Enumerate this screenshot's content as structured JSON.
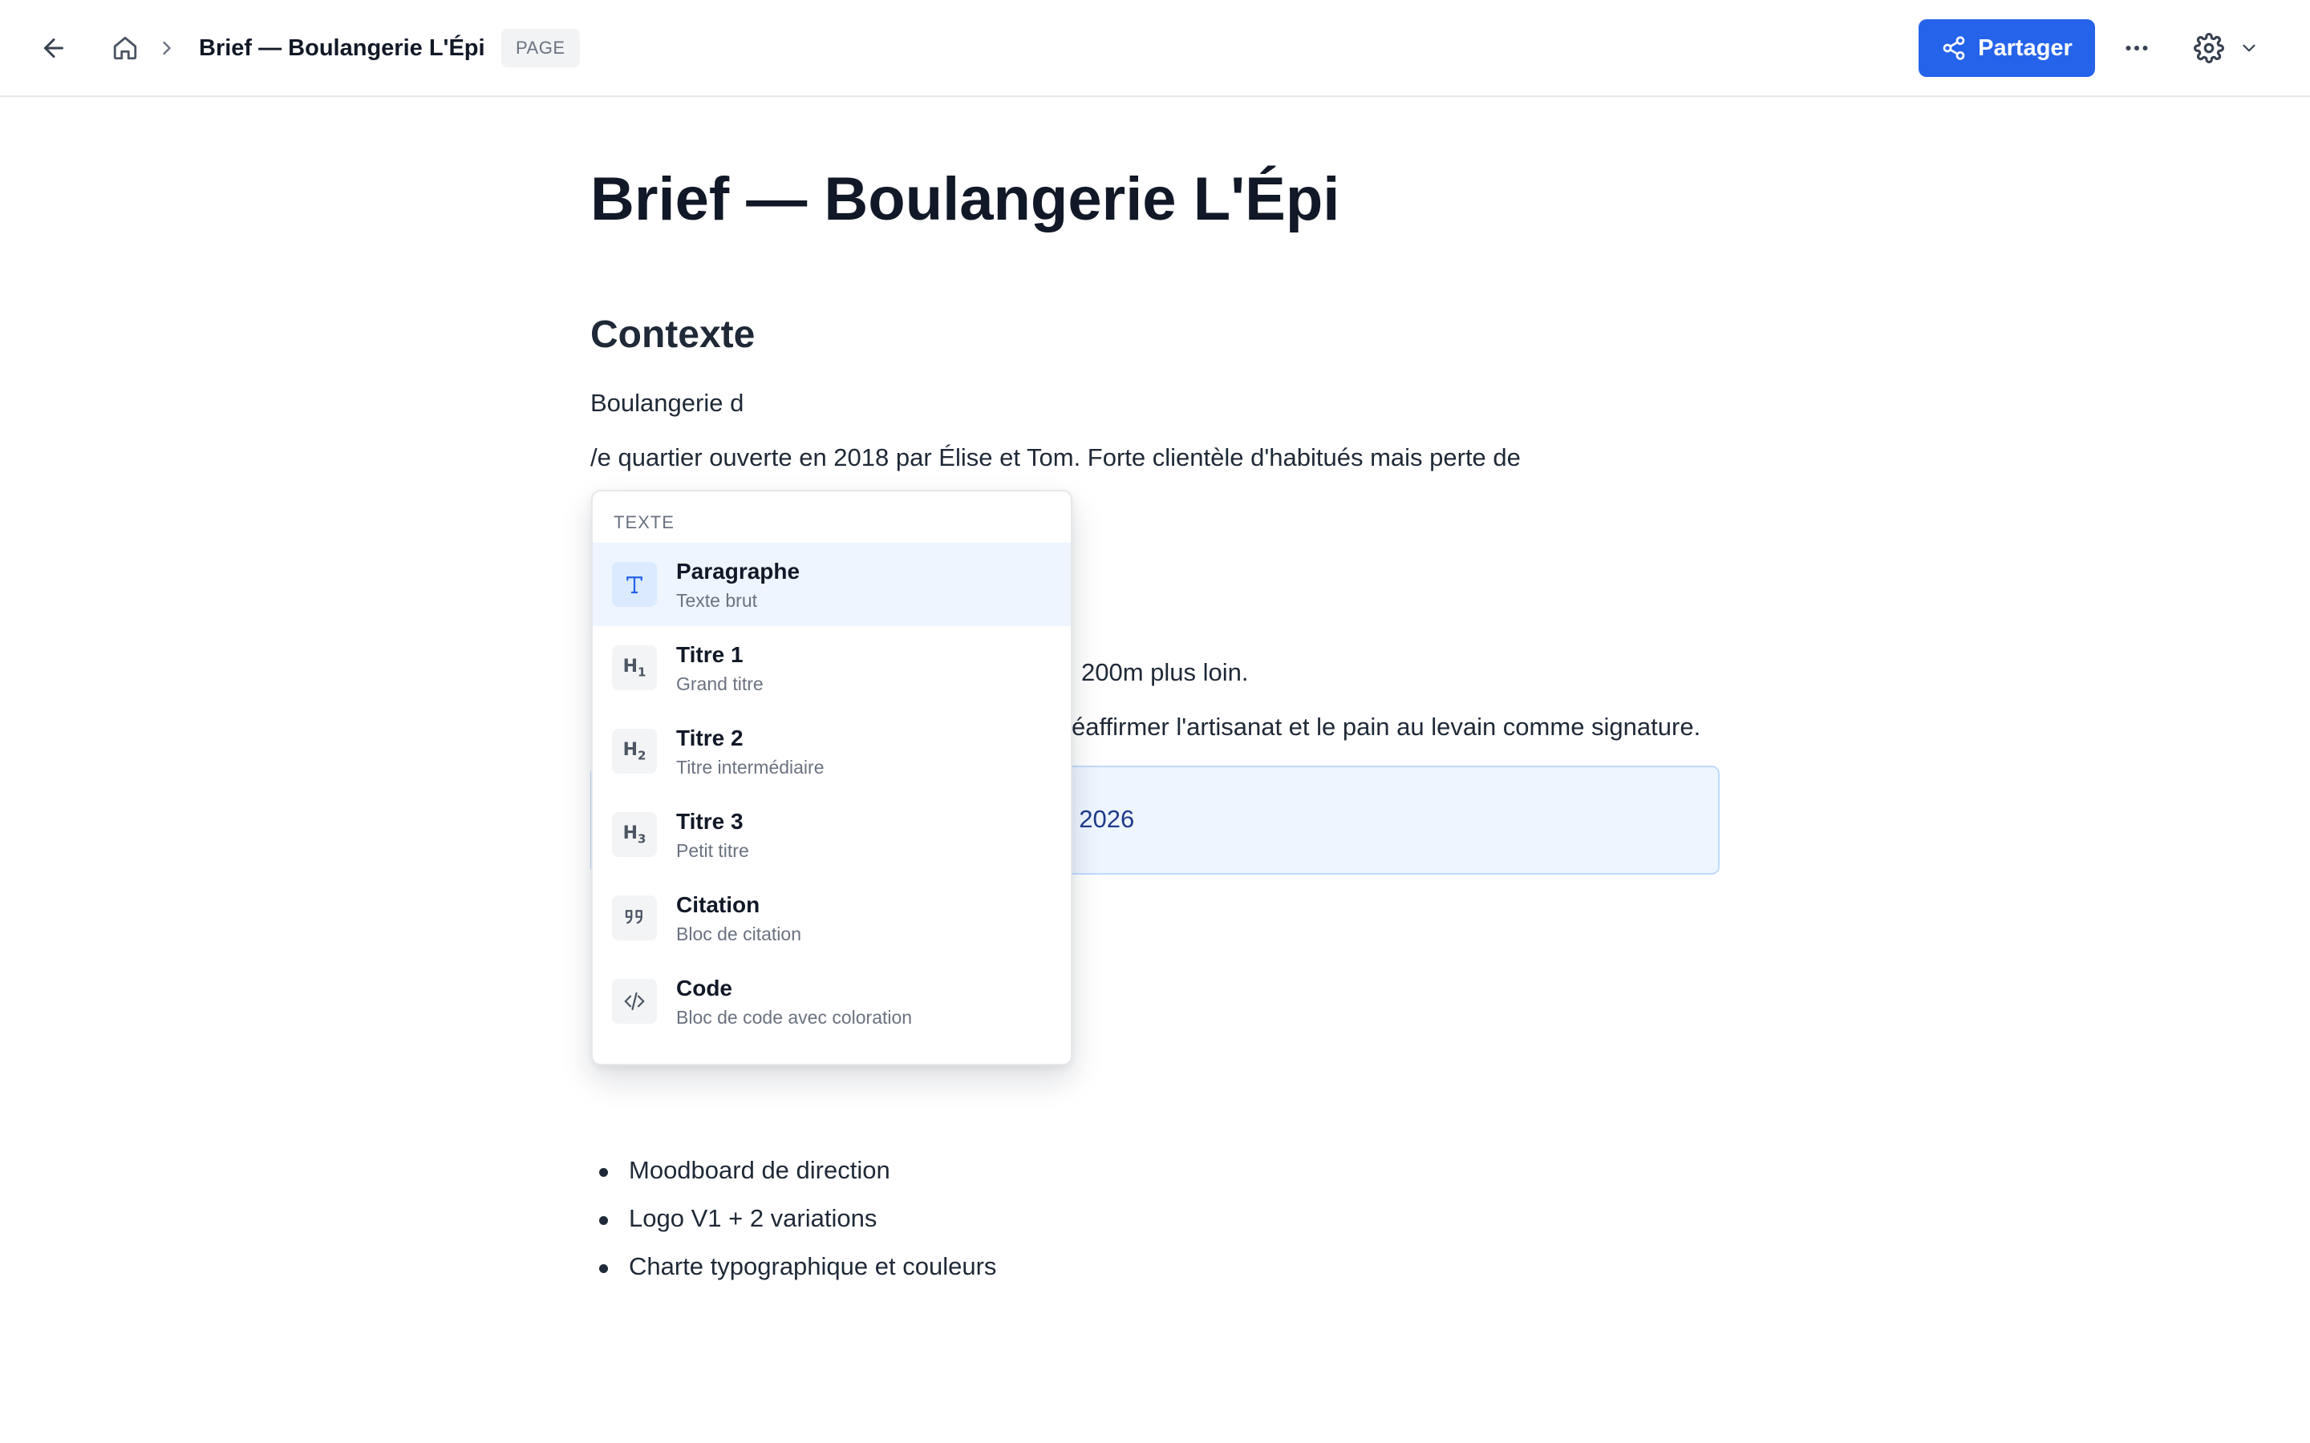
{
  "topbar": {
    "breadcrumb_title": "Brief — Boulangerie L'Épi",
    "page_badge": "PAGE",
    "share_label": "Partager"
  },
  "document": {
    "title": "Brief — Boulangerie L'Épi",
    "section_heading": "Contexte",
    "paragraph_1": "Boulangerie d",
    "paragraph_2": "/e quartier ouverte en 2018 par Élise et Tom. Forte clientèle d'habitués mais perte de",
    "paragraph_3_visible": "200m plus loin.",
    "paragraph_4_visible": "éaffirmer l'artisanat et le pain au levain comme signature.",
    "callout_visible": ": 2026",
    "bullets": [
      "Moodboard de direction",
      "Logo V1 + 2 variations",
      "Charte typographique et couleurs"
    ]
  },
  "slash_menu": {
    "section_label": "TEXTE",
    "items": [
      {
        "label": "Paragraphe",
        "description": "Texte brut",
        "icon": "paragraph-icon"
      },
      {
        "label": "Titre 1",
        "description": "Grand titre",
        "icon": "heading-1-icon"
      },
      {
        "label": "Titre 2",
        "description": "Titre intermédiaire",
        "icon": "heading-2-icon"
      },
      {
        "label": "Titre 3",
        "description": "Petit titre",
        "icon": "heading-3-icon"
      },
      {
        "label": "Citation",
        "description": "Bloc de citation",
        "icon": "quote-icon"
      },
      {
        "label": "Code",
        "description": "Bloc de code avec coloration",
        "icon": "code-icon"
      }
    ],
    "active_index": 0
  },
  "colors": {
    "accent": "#2563eb",
    "menu_active_bg": "#eef5ff",
    "callout_bg": "#eef5ff",
    "callout_border": "#bfdbfe"
  }
}
